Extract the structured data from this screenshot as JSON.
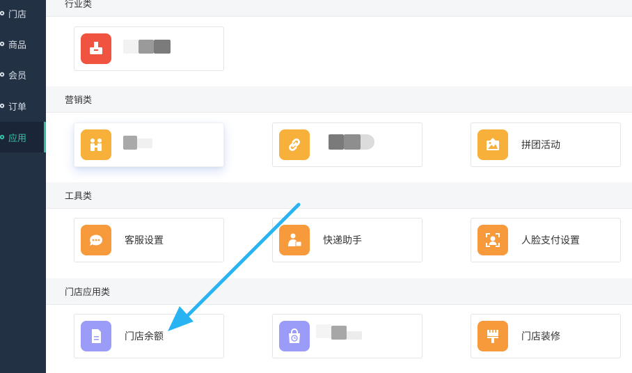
{
  "sidebar": {
    "items": [
      {
        "label": "门店",
        "active": false
      },
      {
        "label": "商品",
        "active": false
      },
      {
        "label": "会员",
        "active": false
      },
      {
        "label": "订单",
        "active": false
      },
      {
        "label": "应用",
        "active": true
      }
    ],
    "colors": {
      "bg": "#233145",
      "active_text": "#34c1a7",
      "text": "#d6dce4"
    }
  },
  "sections": {
    "industry": {
      "title": "行业类"
    },
    "marketing": {
      "title": "营销类"
    },
    "tools": {
      "title": "工具类"
    },
    "store_apps": {
      "title": "门店应用类"
    }
  },
  "apps": {
    "industry_app": {
      "label": "",
      "icon": "inbox-download-icon",
      "color": "#f0533f"
    },
    "marketing_app_1": {
      "label": "",
      "icon": "people-icon",
      "color": "#f7b13a"
    },
    "marketing_app_2": {
      "label": "",
      "icon": "link-icon",
      "color": "#f7b13a"
    },
    "group_buy": {
      "label": "拼团活动",
      "icon": "picture-icon",
      "color": "#f7b13a"
    },
    "customer_service": {
      "label": "客服设置",
      "icon": "chat-bubble-icon",
      "color": "#f79a3b"
    },
    "delivery": {
      "label": "快递助手",
      "icon": "courier-icon",
      "color": "#f79a3b"
    },
    "face_pay": {
      "label": "人脸支付设置",
      "icon": "face-scan-icon",
      "color": "#f79a3b"
    },
    "store_balance": {
      "label": "门店余额",
      "icon": "document-icon",
      "color": "#9b9cf8"
    },
    "store_app_2": {
      "label": "",
      "icon": "shopping-bag-clock-icon",
      "color": "#9b9cf8"
    },
    "store_decoration": {
      "label": "门店装修",
      "icon": "paint-brush-icon",
      "color": "#f79a3b"
    }
  },
  "annotation": {
    "arrow_color": "#2ab3f2",
    "arrow_target": "门店余额"
  }
}
